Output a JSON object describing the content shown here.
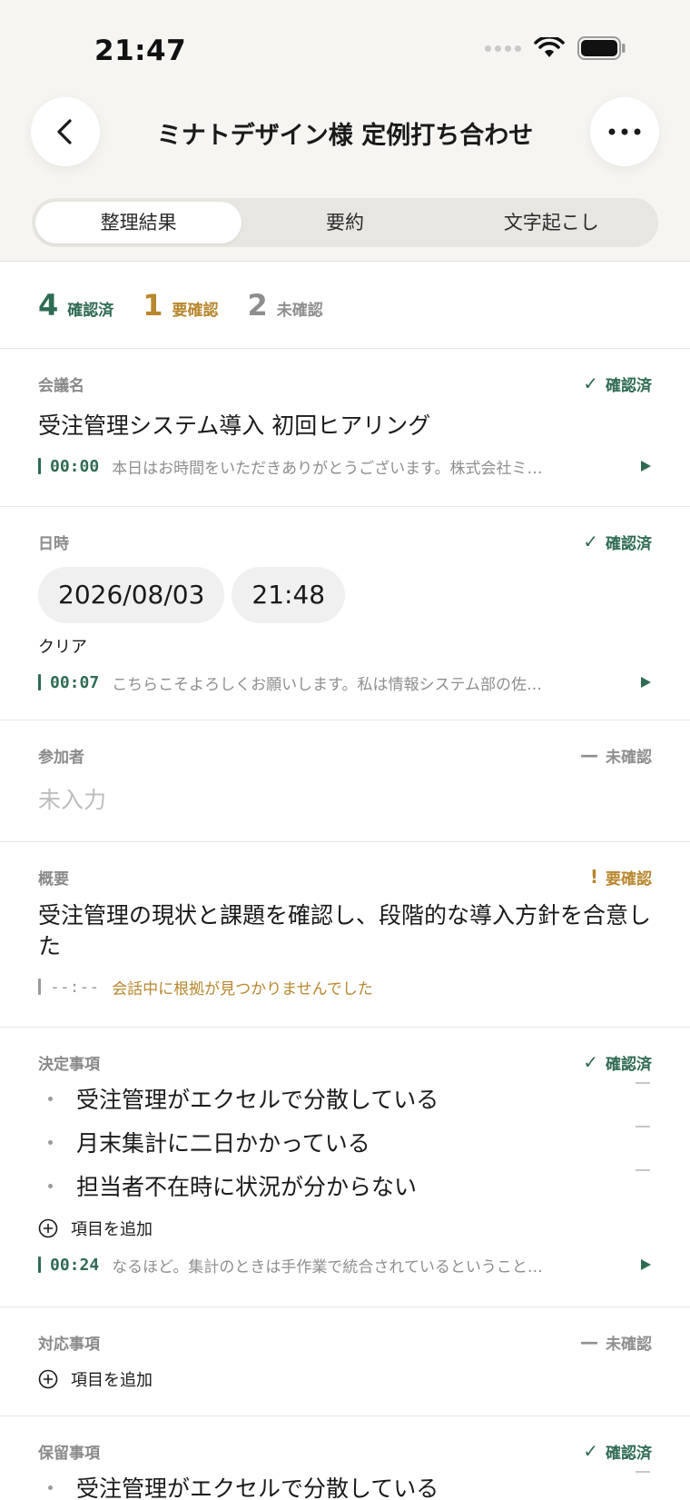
{
  "status_bar": {
    "time": "21:47"
  },
  "nav": {
    "title": "ミナトデザイン様 定例打ち合わせ"
  },
  "tabs": [
    {
      "label": "整理結果",
      "active": true
    },
    {
      "label": "要約",
      "active": false
    },
    {
      "label": "文字起こし",
      "active": false
    }
  ],
  "summary": {
    "confirmed": {
      "count": "4",
      "label": "確認済"
    },
    "needs_check": {
      "count": "1",
      "label": "要確認"
    },
    "unconfirmed": {
      "count": "2",
      "label": "未確認"
    }
  },
  "sections": {
    "meeting_name": {
      "label": "会議名",
      "status": "確認済",
      "value": "受注管理システム導入 初回ヒアリング",
      "evidence_time": "00:00",
      "evidence_text": "本日はお時間をいただきありがとうございます。株式会社ミ…"
    },
    "datetime": {
      "label": "日時",
      "status": "確認済",
      "date": "2026/08/03",
      "time": "21:48",
      "clear": "クリア",
      "evidence_time": "00:07",
      "evidence_text": "こちらこそよろしくお願いします。私は情報システム部の佐…"
    },
    "participants": {
      "label": "参加者",
      "status": "未確認",
      "placeholder": "未入力"
    },
    "overview": {
      "label": "概要",
      "status": "要確認",
      "value": "受注管理の現状と課題を確認し、段階的な導入方針を合意した",
      "evidence_time": "--:--",
      "evidence_text": "会話中に根拠が見つかりませんでした"
    },
    "decisions": {
      "label": "決定事項",
      "status": "確認済",
      "items": [
        "受注管理がエクセルで分散している",
        "月末集計に二日かかっている",
        "担当者不在時に状況が分からない"
      ],
      "add_label": "項目を追加",
      "evidence_time": "00:24",
      "evidence_text": "なるほど。集計のときは手作業で統合されているということ…"
    },
    "actions": {
      "label": "対応事項",
      "status": "未確認",
      "add_label": "項目を追加"
    },
    "pending": {
      "label": "保留事項",
      "status": "確認済",
      "items": [
        "受注管理がエクセルで分散している"
      ]
    }
  },
  "colors": {
    "confirmed": "#2e6b53",
    "needs_check": "#b8872e",
    "unconfirmed": "#8e8e8e",
    "header_bg": "#f6f5f1"
  }
}
